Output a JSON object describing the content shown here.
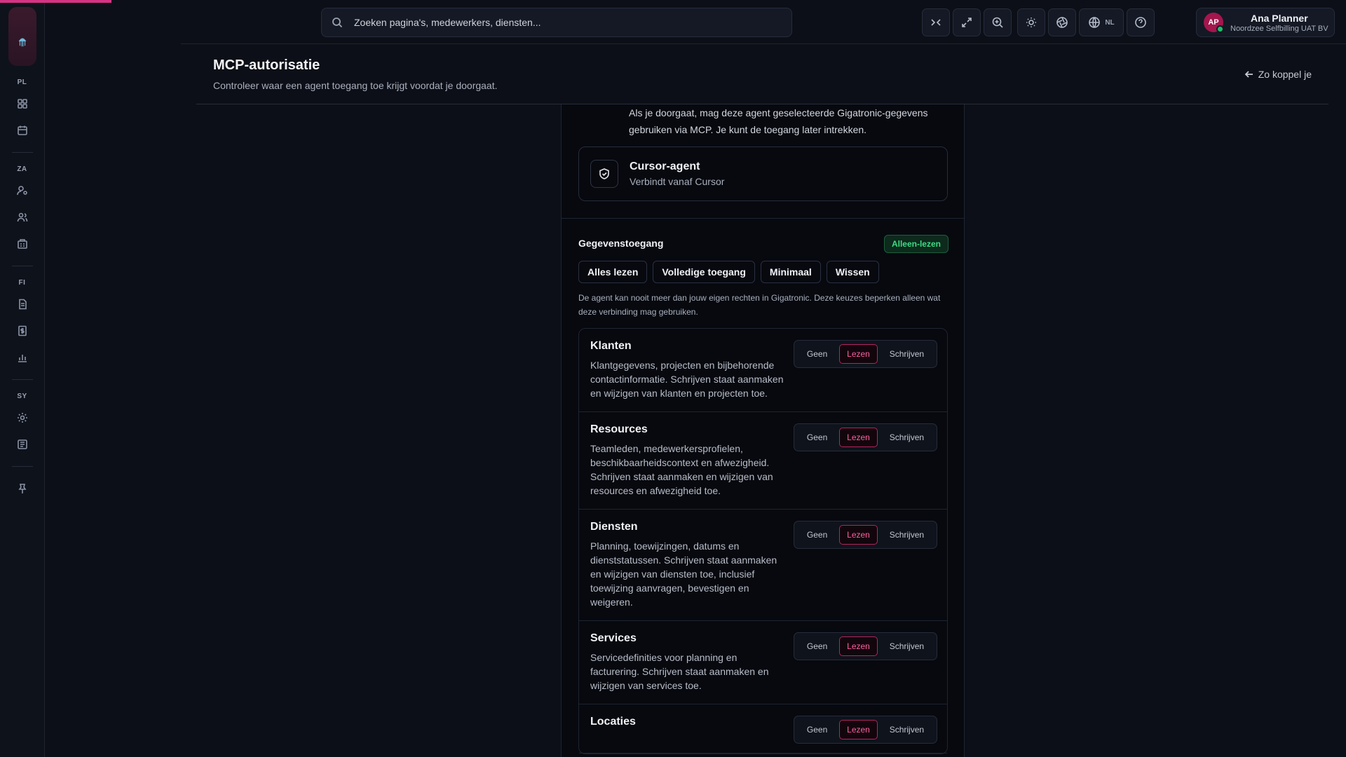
{
  "progress": {
    "percent": 8.3,
    "color": "#d63384"
  },
  "rail": {
    "sections": {
      "pl": "PL",
      "za": "ZA",
      "fi": "FI",
      "sy": "SY"
    },
    "icons": [
      "dashboard-icon",
      "calendar-icon",
      "user-cog-icon",
      "users-icon",
      "building-icon",
      "document-icon",
      "invoice-icon",
      "chart-icon",
      "settings-icon",
      "log-icon",
      "pin-icon"
    ]
  },
  "search": {
    "placeholder": "Zoeken pagina's, medewerkers, diensten..."
  },
  "toolbar": {
    "language": "NL"
  },
  "user": {
    "initials": "AP",
    "name": "Ana Planner",
    "org": "Noordzee Selfbilling UAT BV"
  },
  "header": {
    "title": "MCP-autorisatie",
    "subtitle": "Controleer waar een agent toegang toe krijgt voordat je doorgaat.",
    "back_label": "Zo koppel je"
  },
  "panel": {
    "intro": "Als je doorgaat, mag deze agent geselecteerde Gigatronic-gegevens gebruiken via MCP. Je kunt de toegang later intrekken.",
    "agent": {
      "name": "Cursor-agent",
      "subtitle": "Verbindt vanaf Cursor"
    },
    "access_title": "Gegevenstoegang",
    "access_badge": "Alleen-lezen",
    "presets": [
      "Alles lezen",
      "Volledige toegang",
      "Minimaal",
      "Wissen"
    ],
    "note": "De agent kan nooit meer dan jouw eigen rechten in Gigatronic. Deze keuzes beperken alleen wat deze verbinding mag gebruiken.",
    "options": [
      "Geen",
      "Lezen",
      "Schrijven"
    ],
    "permissions": [
      {
        "name": "Klanten",
        "desc": "Klantgegevens, projecten en bijbehorende contactinformatie. Schrijven staat aanmaken en wijzigen van klanten en projecten toe.",
        "selected": "Lezen"
      },
      {
        "name": "Resources",
        "desc": "Teamleden, medewerkersprofielen, beschikbaarheidscontext en afwezigheid. Schrijven staat aanmaken en wijzigen van resources en afwezigheid toe.",
        "selected": "Lezen"
      },
      {
        "name": "Diensten",
        "desc": "Planning, toewijzingen, datums en dienststatussen. Schrijven staat aanmaken en wijzigen van diensten toe, inclusief toewijzing aanvragen, bevestigen en weigeren.",
        "selected": "Lezen"
      },
      {
        "name": "Services",
        "desc": "Servicedefinities voor planning en facturering. Schrijven staat aanmaken en wijzigen van services toe.",
        "selected": "Lezen"
      },
      {
        "name": "Locaties",
        "desc": "",
        "selected": "Lezen"
      }
    ]
  }
}
